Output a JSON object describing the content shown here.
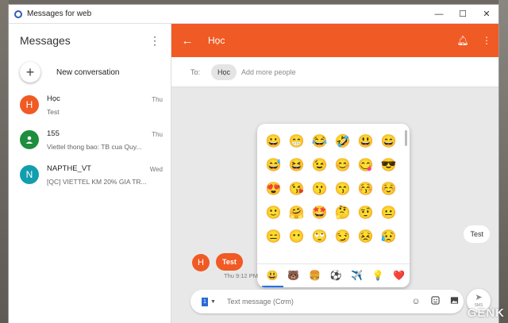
{
  "window": {
    "title": "Messages for web",
    "controls": [
      "—",
      "☐",
      "✕"
    ]
  },
  "sidebar": {
    "title": "Messages",
    "new_conversation": "New conversation",
    "conversations": [
      {
        "initial": "H",
        "name": "Học",
        "snippet": "Test",
        "time": "Thu",
        "color": "#f05a24"
      },
      {
        "initial": "",
        "name": "155",
        "snippet": "Viettel thong bao: TB cua Quy...",
        "time": "Thu",
        "color": "#1e8e3e"
      },
      {
        "initial": "N",
        "name": "NAPTHE_VT",
        "snippet": "[QC] VIETTEL KM 20% GIA TR...",
        "time": "Wed",
        "color": "#129eaf"
      }
    ]
  },
  "header": {
    "title": "Học",
    "accent": "#f05a24"
  },
  "to_row": {
    "label": "To:",
    "recipient": "Học",
    "add_more_placeholder": "Add more people"
  },
  "emoji_panel": {
    "emojis": [
      "😀",
      "😁",
      "😂",
      "🤣",
      "😃",
      "😄",
      "😅",
      "😆",
      "😉",
      "😊",
      "😋",
      "😎",
      "😍",
      "😘",
      "😗",
      "😙",
      "😚",
      "☺️",
      "🙂",
      "🤗",
      "🤩",
      "🤔",
      "🤨",
      "😐",
      "😑",
      "😶",
      "🙄",
      "😏",
      "😣",
      "😥"
    ],
    "tabs": [
      "😃",
      "🐻",
      "🍔",
      "⚽",
      "✈️",
      "💡",
      "❤️"
    ],
    "active_tab_color": "#1e73e8"
  },
  "messages": {
    "incoming": "Test",
    "outgoing": "Test",
    "outgoing_avatar": "H",
    "outgoing_time": "Thu 9:12 PM"
  },
  "composer": {
    "sim": "1",
    "placeholder": "Text message (Cơm)",
    "send_label": "SMS"
  },
  "watermark": "GENK"
}
